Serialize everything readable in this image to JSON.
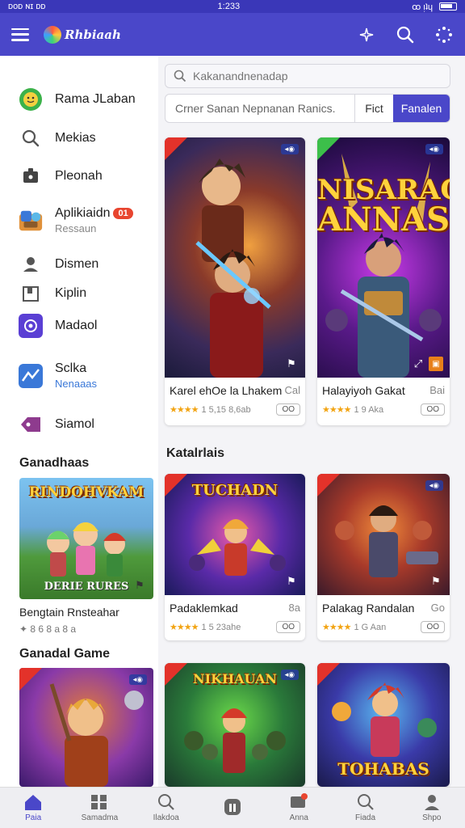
{
  "status_bar": {
    "left": "ᴅᴏᴅ ɴɪ ᴅᴅ",
    "time": "1:233",
    "right": "ꝏ ᴉʇɥ"
  },
  "app": {
    "logo_text": "Rhbiaah"
  },
  "search": {
    "placeholder": "Kakanandnenadap"
  },
  "filter": {
    "text": "Crner Sanan Nepnanan Ranics.",
    "button1": "Fict",
    "button2": "Fanalen"
  },
  "sidebar": {
    "items": [
      {
        "label": "Rama JLaban",
        "icon": "emoji-icon"
      },
      {
        "label": "Mekias",
        "icon": "search-icon"
      },
      {
        "label": "Pleonah",
        "icon": "puzzle-icon"
      },
      {
        "label": "Aplikiaidn",
        "badge": "01",
        "sub": "Ressaun",
        "icon": "toolbox-icon"
      },
      {
        "label": "Dismen",
        "icon": "person-icon"
      },
      {
        "label": "Kiplin",
        "icon": "bookmark-icon"
      },
      {
        "label": "Madaol",
        "icon": "camera-icon"
      },
      {
        "label": "Sclka",
        "sub": "Nenaaas",
        "icon": "chart-icon"
      },
      {
        "label": "Siamol",
        "icon": "tag-icon"
      }
    ],
    "section1": "Ganadhaas",
    "card": {
      "art_title": "RINDOHVKAM",
      "art_sub": "DERIE RURES",
      "title": "Bengtain Rnsteahar",
      "meta": "✦ 8 6 8 a 8 a"
    },
    "section2": "Ganadal Game"
  },
  "main": {
    "featured": [
      {
        "title": "Karel ehOe la Lhakem",
        "price": "Cal",
        "rating_text": "1 5,15 8,6ab",
        "stars": "★★★★",
        "chip": "◂◉",
        "dl": "OO"
      },
      {
        "title": "Halayiyoh Gakat",
        "price": "Bai",
        "rating_text": "1 9 Aka",
        "stars": "★★★★",
        "chip": "◂◉",
        "dl": "OO",
        "art_title_1": "NISARAG",
        "art_title_2": "ANNAS"
      }
    ],
    "section": "Katalrlais",
    "grid": [
      {
        "title": "Padaklemkad",
        "price": "8a",
        "rating_text": "1 5 23ahe",
        "stars": "★★★★",
        "dl": "OO",
        "art_title": "TUCHADN"
      },
      {
        "title": "Palakag Randalan",
        "price": "Go",
        "rating_text": "1 G Aan",
        "stars": "★★★★",
        "dl": "OO"
      }
    ],
    "bottom_row": [
      {
        "art_title": ""
      },
      {
        "art_title": "NIKHAUAN"
      },
      {
        "art_title": "TOHABAS"
      }
    ]
  },
  "bottom_nav": [
    {
      "label": "Paia",
      "icon": "home-icon",
      "active": true
    },
    {
      "label": "Samadma",
      "icon": "grid-icon"
    },
    {
      "label": "Ilakdoa",
      "icon": "search-icon"
    },
    {
      "label": "",
      "icon": "library-icon"
    },
    {
      "label": "Anna",
      "icon": "notification-icon"
    },
    {
      "label": "Fiada",
      "icon": "search-icon"
    },
    {
      "label": "Shpo",
      "icon": "profile-icon"
    }
  ],
  "colors": {
    "accent": "#4a47c9",
    "status_bar": "#3a37b8",
    "badge": "#e8452f",
    "stars": "#f2a413"
  }
}
